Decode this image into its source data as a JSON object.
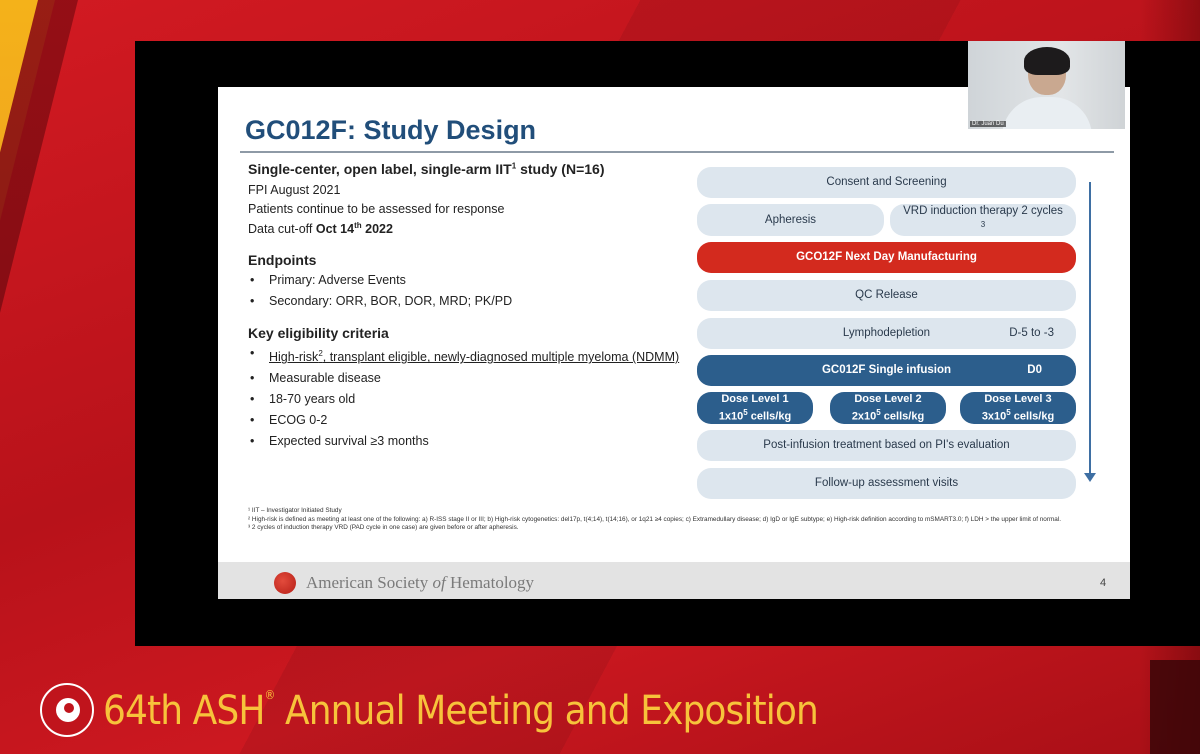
{
  "slide": {
    "title": "GC012F: Study Design",
    "subtitle_text": "Single-center, open label, single-arm IIT",
    "subtitle_sup": "1",
    "subtitle_end": " study (N=16)",
    "info": [
      "FPI August 2021",
      "Patients continue to be assessed for response"
    ],
    "datacut_prefix": "Data cut-off ",
    "datacut_bold": "Oct 14",
    "datacut_sup": "th",
    "datacut_year": " 2022",
    "endpoints_heading": "Endpoints",
    "endpoints": [
      "Primary: Adverse Events",
      "Secondary: ORR, BOR, DOR, MRD; PK/PD"
    ],
    "eligibility_heading": "Key eligibility criteria",
    "elig_first_a": "High-risk",
    "elig_first_sup": "2",
    "elig_first_b": ", transplant eligible, newly-diagnosed multiple myeloma (NDMM)",
    "eligibility": [
      "Measurable disease",
      "18-70 years old",
      "ECOG 0-2",
      "Expected survival ≥3 months"
    ],
    "flow": {
      "consent": "Consent and Screening",
      "apheresis": "Apheresis",
      "vrd": "VRD induction therapy 2 cycles",
      "vrd_sup": "3",
      "manufacturing": "GCO12F Next Day Manufacturing",
      "qc": "QC Release",
      "lympho": "Lymphodepletion",
      "lympho_day": "D-5 to -3",
      "infusion": "GC012F Single infusion",
      "infusion_day": "D0",
      "doses": [
        {
          "label": "Dose Level 1",
          "value": "1x10",
          "sup": "5",
          "unit": " cells/kg"
        },
        {
          "label": "Dose Level 2",
          "value": "2x10",
          "sup": "5",
          "unit": " cells/kg"
        },
        {
          "label": "Dose Level 3",
          "value": "3x10",
          "sup": "5",
          "unit": " cells/kg"
        }
      ],
      "post": "Post-infusion treatment based on PI's evaluation",
      "followup": "Follow-up assessment visits"
    },
    "footnotes": [
      "¹ IIT – Investigator Initiated Study",
      "² High-risk is defined as meeting at least one of the following: a) R-ISS stage II or III; b) High-risk cytogenetics: del17p, t(4;14), t(14;16), or 1q21 ≥4 copies; c) Extramedullary disease; d) IgD or IgE subtype; e) High-risk definition according to mSMART3.0; f) LDH > the upper limit of normal.",
      "³ 2 cycles of induction therapy VRD (PAD cycle in one case) are given before or after apheresis."
    ],
    "footer_society_a": "American Society ",
    "footer_society_of": "of",
    "footer_society_b": " Hematology",
    "page_number": "4"
  },
  "speaker": {
    "name": "Dr. Juan Du"
  },
  "meeting": {
    "title_a": "64th ASH",
    "title_reg": "®",
    "title_b": " Annual Meeting and Exposition"
  },
  "colors": {
    "title_blue": "#214e7a",
    "flow_red": "#d32a1e",
    "flow_blue": "#2c5e8c",
    "flow_grey": "#dde6ee",
    "banner_gold": "#f7c33b"
  }
}
